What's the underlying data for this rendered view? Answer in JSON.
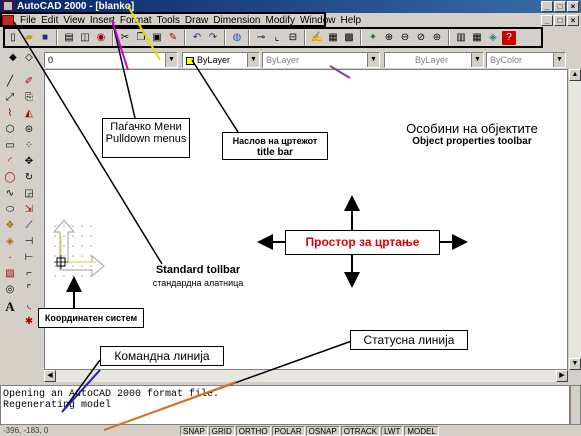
{
  "window": {
    "title": "AutoCAD 2000 - [blanko]",
    "controls": [
      "_",
      "□",
      "×"
    ]
  },
  "menu": {
    "items": [
      "File",
      "Edit",
      "View",
      "Insert",
      "Format",
      "Tools",
      "Draw",
      "Dimension",
      "Modify",
      "Window",
      "Help"
    ],
    "doc_controls": [
      "_",
      "□",
      "×"
    ]
  },
  "properties": {
    "layer_value": "0",
    "color_value": "ByLayer",
    "linetype_value": "ByLayer",
    "lineweight_value": "ByLayer",
    "plotstyle_value": "ByColor"
  },
  "command_window": {
    "lines": [
      "Opening an AutoCAD 2000 format file.",
      "Regenerating model"
    ]
  },
  "status_bar": {
    "coords": "-396, -183, 0",
    "buttons": [
      "SNAP",
      "GRID",
      "ORTHO",
      "POLAR",
      "OSNAP",
      "OTRACK",
      "LWT",
      "MODEL"
    ]
  },
  "annotations": {
    "pulldown_mk": "Паѓачко Мени",
    "pulldown_en": "Pulldown menus",
    "titlebar_mk": "Наслов на цртежот",
    "titlebar_en": "title bar",
    "objprops_mk": "Особини на објектите",
    "objprops_en": "Object properties toolbar",
    "standard_en": "Standard tollbar",
    "standard_mk": "стандардна алатница",
    "coord_mk": "Координатен систем",
    "drawing_space": "Простор за цртање",
    "command_line": "Командна линија",
    "status_line": "Статусна линија"
  },
  "colors": {
    "drawing_space_text": "#e00000",
    "titlebar_start": "#0a246a"
  },
  "icons": {
    "standard_toolbar": [
      "new-icon",
      "open-icon",
      "save-icon",
      "print-icon",
      "preview-icon",
      "spell-icon",
      "cut-icon",
      "copy-icon",
      "paste-icon",
      "matchprop-icon",
      "undo-icon",
      "redo-icon",
      "hyperlink-icon",
      "tracking-icon",
      "ucs-icon",
      "distance-icon",
      "redraw-icon",
      "aerial-icon",
      "pan-icon",
      "zoom-icon",
      "zoom-window-icon",
      "zoom-previous-icon",
      "properties-icon",
      "designcenter-icon",
      "dbconnect-icon",
      "help-icon"
    ],
    "draw_toolbar": [
      "line-icon",
      "xline-icon",
      "polyline-icon",
      "polygon-icon",
      "rectangle-icon",
      "arc-icon",
      "circle-icon",
      "spline-icon",
      "ellipse-icon",
      "insert-block-icon",
      "make-block-icon",
      "point-icon",
      "hatch-icon",
      "region-icon",
      "mtext-icon"
    ],
    "modify_toolbar": [
      "erase-icon",
      "copy-object-icon",
      "mirror-icon",
      "offset-icon",
      "array-icon",
      "move-icon",
      "rotate-icon",
      "scale-icon",
      "stretch-icon",
      "lengthen-icon",
      "trim-icon",
      "extend-icon",
      "break-icon",
      "chamfer-icon",
      "fillet-icon",
      "explode-icon"
    ]
  }
}
